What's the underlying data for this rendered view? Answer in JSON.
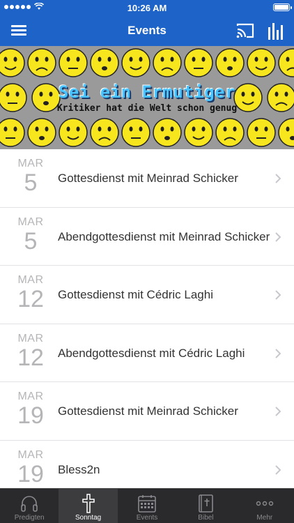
{
  "status_bar": {
    "time": "10:26 AM"
  },
  "nav": {
    "title": "Events"
  },
  "banner": {
    "title": "Sei ein Ermutiger",
    "subtitle": "Kritiker hat die Welt schon genug"
  },
  "events": [
    {
      "month": "MAR",
      "day": "5",
      "title": "Gottesdienst mit Meinrad Schicker"
    },
    {
      "month": "MAR",
      "day": "5",
      "title": "Abendgottesdienst mit Meinrad Schicker"
    },
    {
      "month": "MAR",
      "day": "12",
      "title": "Gottesdienst mit Cédric Laghi"
    },
    {
      "month": "MAR",
      "day": "12",
      "title": "Abendgottesdienst mit Cédric Laghi"
    },
    {
      "month": "MAR",
      "day": "19",
      "title": "Gottesdienst mit Meinrad Schicker"
    },
    {
      "month": "MAR",
      "day": "19",
      "title": "Bless2n"
    }
  ],
  "tabs": [
    {
      "label": "Predigten",
      "icon": "headphones-icon"
    },
    {
      "label": "Sonntag",
      "icon": "cross-icon",
      "active": true
    },
    {
      "label": "Events",
      "icon": "calendar-icon"
    },
    {
      "label": "Bibel",
      "icon": "bible-icon"
    },
    {
      "label": "Mehr",
      "icon": "more-icon"
    }
  ],
  "colors": {
    "brand_blue": "#1e64c8",
    "tab_bar": "#2a2a2c",
    "date_gray": "#b5b5b8",
    "emoji_yellow": "#f7e51d"
  }
}
